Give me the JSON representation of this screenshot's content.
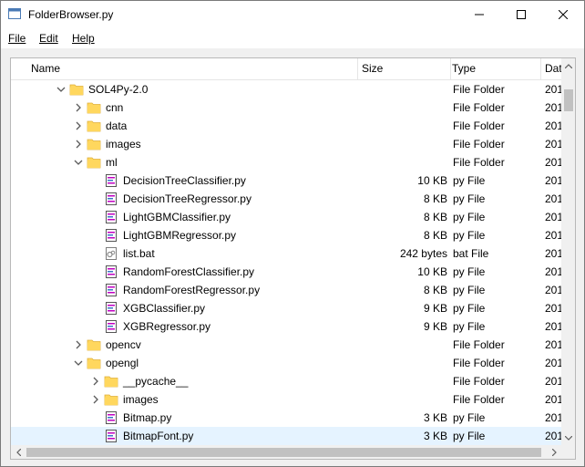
{
  "window": {
    "title": "FolderBrowser.py"
  },
  "menu": [
    {
      "label": "File"
    },
    {
      "label": "Edit"
    },
    {
      "label": "Help"
    }
  ],
  "columns": [
    {
      "label": "Name"
    },
    {
      "label": "Size"
    },
    {
      "label": "Type"
    },
    {
      "label": "Dat"
    }
  ],
  "rows": [
    {
      "name": "SOL4Py-2.0",
      "size": "",
      "type": "File Folder",
      "date": "201",
      "icon": "folder-icon",
      "expander": "expanded",
      "depth": 0
    },
    {
      "name": "cnn",
      "size": "",
      "type": "File Folder",
      "date": "201",
      "icon": "folder-icon",
      "expander": "collapsed",
      "depth": 1
    },
    {
      "name": "data",
      "size": "",
      "type": "File Folder",
      "date": "201",
      "icon": "folder-icon",
      "expander": "collapsed",
      "depth": 1
    },
    {
      "name": "images",
      "size": "",
      "type": "File Folder",
      "date": "201",
      "icon": "folder-icon",
      "expander": "collapsed",
      "depth": 1
    },
    {
      "name": "ml",
      "size": "",
      "type": "File Folder",
      "date": "201",
      "icon": "folder-icon",
      "expander": "expanded",
      "depth": 1
    },
    {
      "name": "DecisionTreeClassifier.py",
      "size": "10 KB",
      "type": "py File",
      "date": "201",
      "icon": "python-file-icon",
      "expander": "none",
      "depth": 2
    },
    {
      "name": "DecisionTreeRegressor.py",
      "size": "8 KB",
      "type": "py File",
      "date": "201",
      "icon": "python-file-icon",
      "expander": "none",
      "depth": 2
    },
    {
      "name": "LightGBMClassifier.py",
      "size": "8 KB",
      "type": "py File",
      "date": "201",
      "icon": "python-file-icon",
      "expander": "none",
      "depth": 2
    },
    {
      "name": "LightGBMRegressor.py",
      "size": "8 KB",
      "type": "py File",
      "date": "201",
      "icon": "python-file-icon",
      "expander": "none",
      "depth": 2
    },
    {
      "name": "list.bat",
      "size": "242 bytes",
      "type": "bat File",
      "date": "201",
      "icon": "batch-file-icon",
      "expander": "none",
      "depth": 2
    },
    {
      "name": "RandomForestClassifier.py",
      "size": "10 KB",
      "type": "py File",
      "date": "201",
      "icon": "python-file-icon",
      "expander": "none",
      "depth": 2
    },
    {
      "name": "RandomForestRegressor.py",
      "size": "8 KB",
      "type": "py File",
      "date": "201",
      "icon": "python-file-icon",
      "expander": "none",
      "depth": 2
    },
    {
      "name": "XGBClassifier.py",
      "size": "9 KB",
      "type": "py File",
      "date": "201",
      "icon": "python-file-icon",
      "expander": "none",
      "depth": 2
    },
    {
      "name": "XGBRegressor.py",
      "size": "9 KB",
      "type": "py File",
      "date": "201",
      "icon": "python-file-icon",
      "expander": "none",
      "depth": 2
    },
    {
      "name": "opencv",
      "size": "",
      "type": "File Folder",
      "date": "201",
      "icon": "folder-icon",
      "expander": "collapsed",
      "depth": 1
    },
    {
      "name": "opengl",
      "size": "",
      "type": "File Folder",
      "date": "201",
      "icon": "folder-icon",
      "expander": "expanded",
      "depth": 1
    },
    {
      "name": "__pycache__",
      "size": "",
      "type": "File Folder",
      "date": "201",
      "icon": "folder-icon",
      "expander": "collapsed",
      "depth": 2
    },
    {
      "name": "images",
      "size": "",
      "type": "File Folder",
      "date": "201",
      "icon": "folder-icon",
      "expander": "collapsed",
      "depth": 2
    },
    {
      "name": "Bitmap.py",
      "size": "3 KB",
      "type": "py File",
      "date": "201",
      "icon": "python-file-icon",
      "expander": "none",
      "depth": 2
    },
    {
      "name": "BitmapFont.py",
      "size": "3 KB",
      "type": "py File",
      "date": "201",
      "icon": "python-file-icon",
      "expander": "none",
      "depth": 2,
      "selected": true
    }
  ],
  "colors": {
    "folder": "#ffd75e",
    "selection": "#e5f3ff",
    "python_accent": "#c000c0"
  }
}
